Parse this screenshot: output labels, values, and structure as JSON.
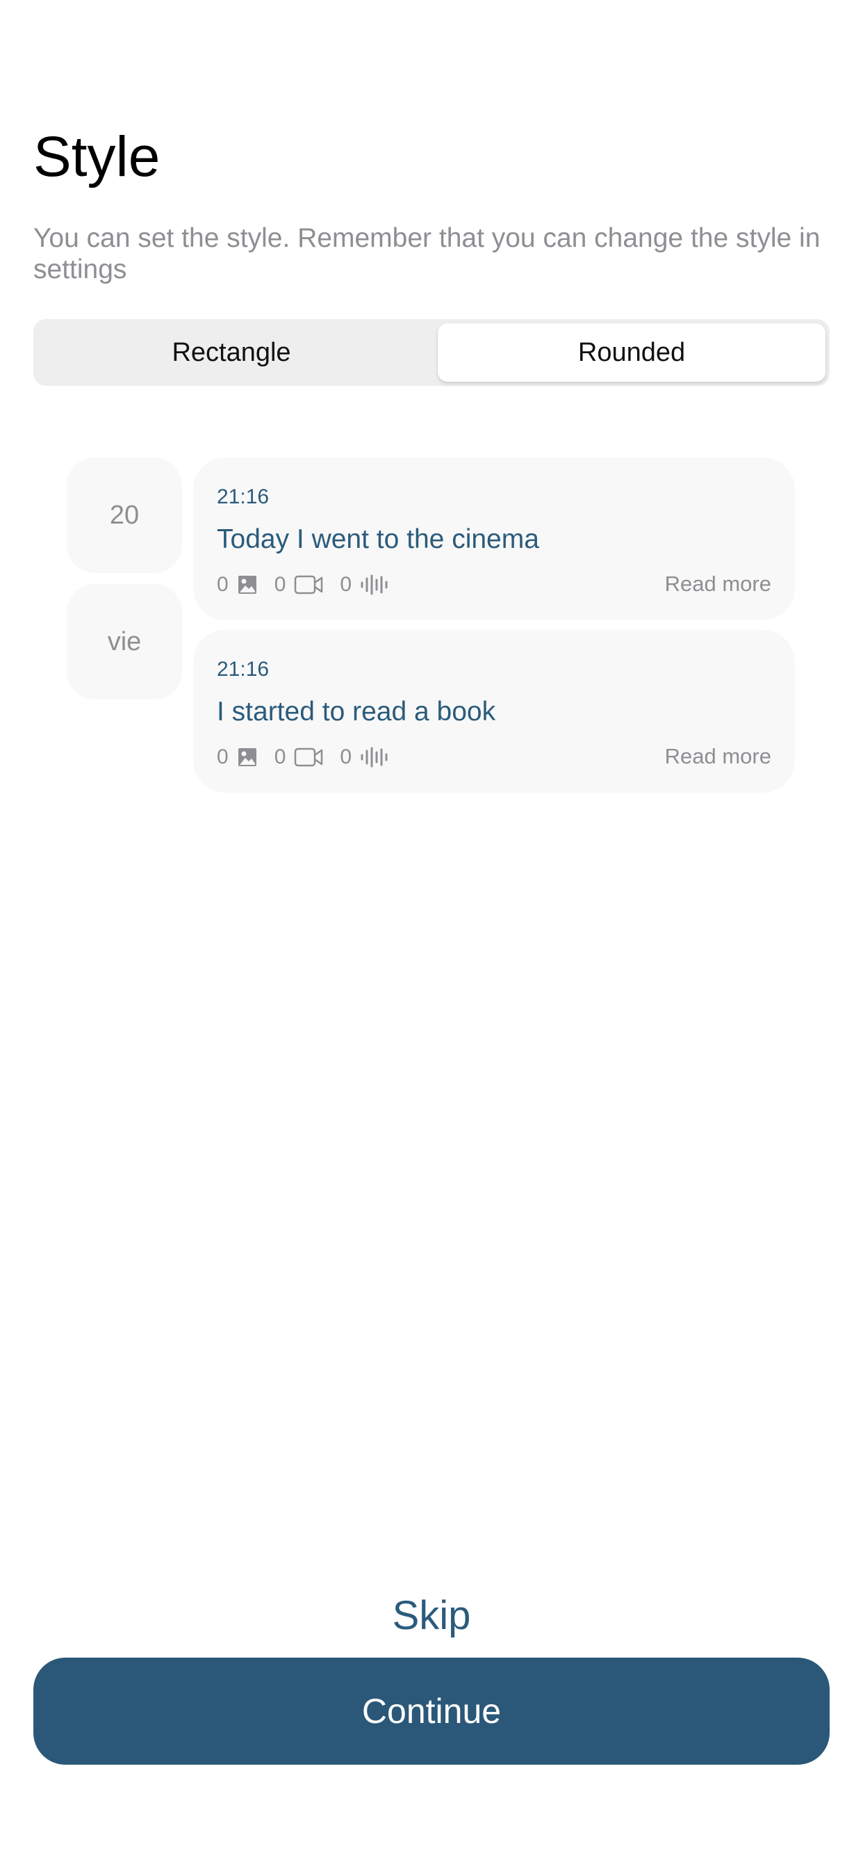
{
  "header": {
    "title": "Style",
    "subtitle": "You can set the style. Remember that you can change the style in settings"
  },
  "style_selector": {
    "options": [
      {
        "label": "Rectangle",
        "selected": false
      },
      {
        "label": "Rounded",
        "selected": true
      }
    ]
  },
  "preview": {
    "date": {
      "day": "20",
      "weekday": "vie"
    },
    "entries": [
      {
        "time": "21:16",
        "title": "Today I went to the cinema",
        "photos": "0",
        "videos": "0",
        "audios": "0",
        "read_more": "Read more"
      },
      {
        "time": "21:16",
        "title": "I started to read a book",
        "photos": "0",
        "videos": "0",
        "audios": "0",
        "read_more": "Read more"
      }
    ],
    "icons": [
      "photo-icon",
      "video-camera-icon",
      "audio-waveform-icon"
    ]
  },
  "footer": {
    "skip_label": "Skip",
    "continue_label": "Continue"
  },
  "colors": {
    "accent": "#2b5878",
    "text_accent": "#2b5b7c",
    "muted": "#8e8e93",
    "card_bg": "#f8f8f8"
  }
}
